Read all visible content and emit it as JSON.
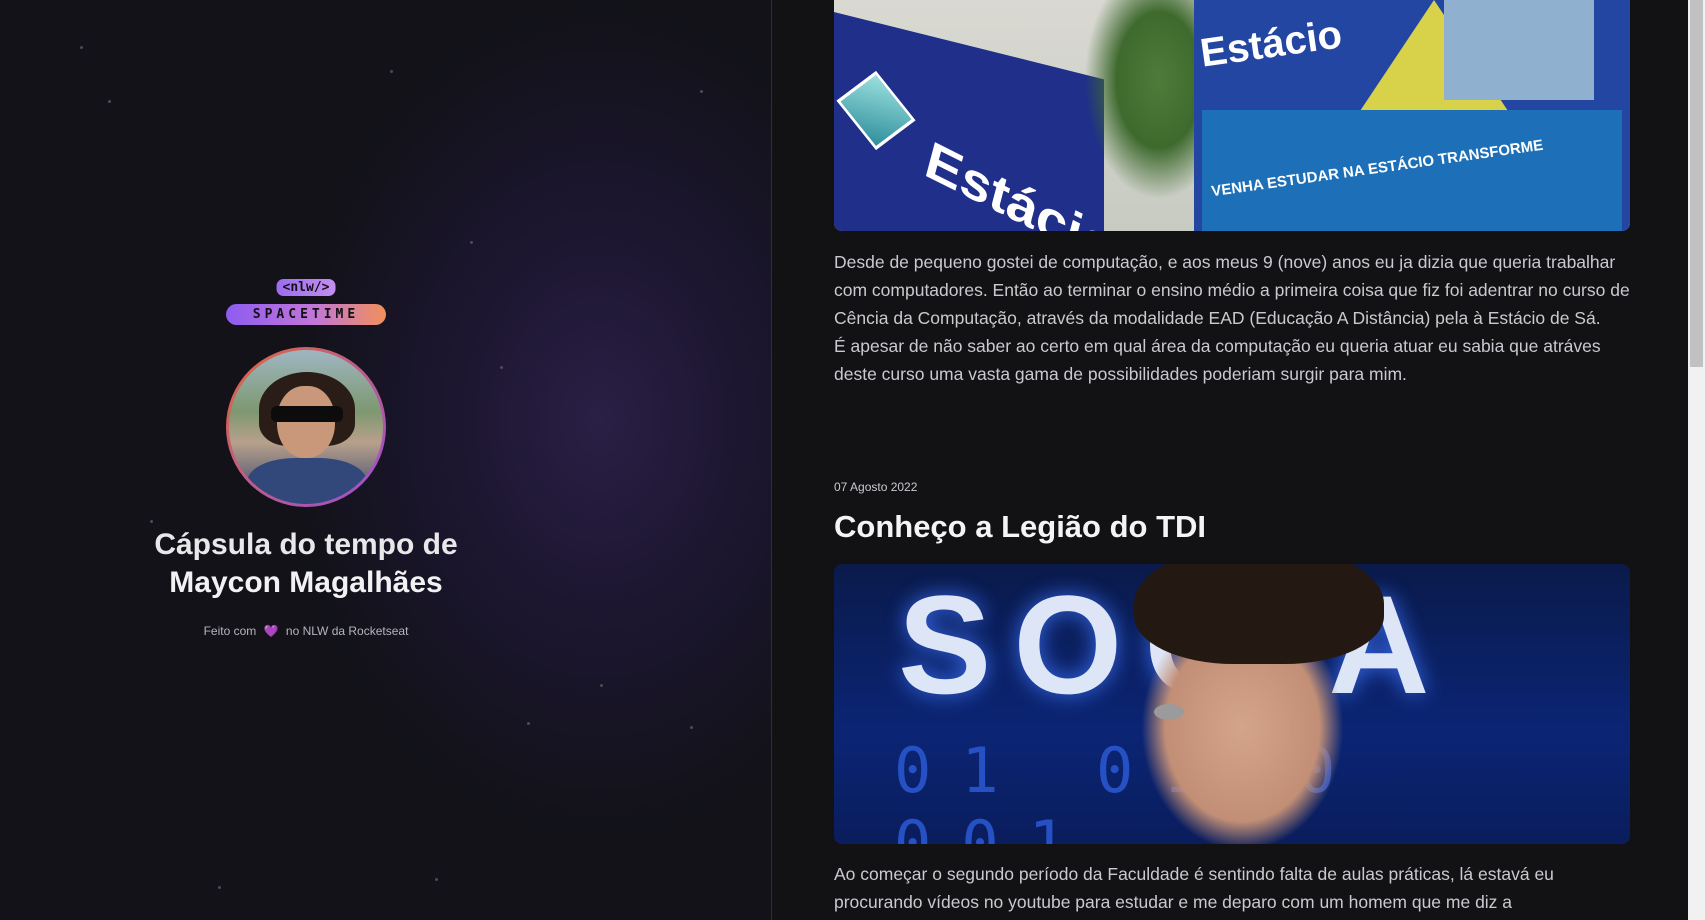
{
  "sidebar": {
    "brand_tag": "<nlw/>",
    "brand_name": "SPACETIME",
    "title_line": "Cápsula do tempo de",
    "name_line": "Maycon Magalhães",
    "footer_prefix": "Feito com",
    "footer_heart": "💜",
    "footer_suffix": "no NLW da Rocketseat"
  },
  "posts": {
    "first": {
      "image_words": {
        "sign": "Estácio",
        "building": "Estácio",
        "panel": "VENHA ESTUDAR NA ESTÁCIO TRANSFORME"
      },
      "paragraph": "Desde de pequeno gostei de computação, e aos meus 9 (nove) anos eu ja dizia que queria trabalhar com computadores. Então ao terminar o ensino médio a primeira coisa que fiz foi adentrar no curso de Cência da Computação, através da modalidade EAD (Educação A Distância) pela à Estácio de Sá.",
      "paragraph2": "É apesar de não saber ao certo em qual área da computação eu queria atuar eu sabia que atráves deste curso uma vasta gama de possibilidades poderiam surgir para mim."
    },
    "second": {
      "date": "07 Agosto 2022",
      "title": "Conheço a Legião do TDI",
      "image_words": {
        "letters": "SOCIA",
        "binary": "01 0110 001"
      },
      "paragraph": "Ao começar o segundo período da Faculdade é sentindo falta de aulas práticas, lá estavá eu procurando vídeos no youtube para estudar e me deparo com um homem que me diz a"
    }
  },
  "colors": {
    "background": "#121215",
    "accent_purple": "#9b5ad8",
    "accent_orange": "#f1905a"
  }
}
